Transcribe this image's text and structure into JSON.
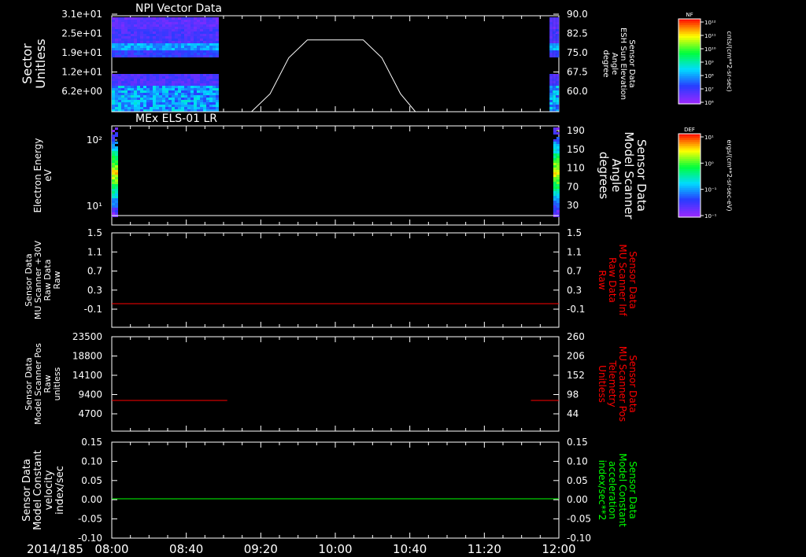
{
  "date_label": "2014/185",
  "time_ticks": [
    "08:00",
    "08:40",
    "09:20",
    "10:00",
    "10:40",
    "11:20",
    "12:00"
  ],
  "colors": {
    "background": "#000000",
    "foreground": "#ffffff",
    "red": "#ff0000",
    "green": "#00ff00"
  },
  "colorbars": [
    {
      "title": "NF",
      "ticks": [
        "10¹²",
        "10¹¹",
        "10¹⁰",
        "10⁹",
        "10⁸",
        "10⁷",
        "10⁶"
      ],
      "units": "cnts/(cm**2-sr-sec)"
    },
    {
      "title": "DEF",
      "ticks": [
        "10¹",
        "10⁰",
        "10⁻¹",
        "10⁻¹"
      ],
      "units": "ergs/(cm**2-sr-sec-eV)"
    }
  ],
  "chart_data": [
    {
      "type": "heatmap",
      "title": "NPI Vector Data",
      "ylabel_lines": [
        "Sector",
        "Unitless"
      ],
      "yticks_left": [
        "3.1e+01",
        "2.5e+01",
        "1.9e+01",
        "1.2e+01",
        "6.2e+00"
      ],
      "right_ylabel_lines": [
        "Sensor Data",
        "ESH Sun Elevation",
        "Angle",
        "degree"
      ],
      "yticks_right": [
        "90.0",
        "82.5",
        "75.0",
        "67.5",
        "60.0"
      ],
      "right_ylim": [
        52.5,
        90.0
      ],
      "line": {
        "x": [
          "08:00",
          "09:15",
          "09:25",
          "09:35",
          "09:45",
          "10:00",
          "10:15",
          "10:25",
          "10:35",
          "10:43",
          "12:00"
        ],
        "y": [
          52.5,
          52.5,
          60.0,
          75.0,
          82.5,
          82.5,
          82.5,
          75.0,
          60.0,
          52.5,
          52.5
        ]
      },
      "data_segments": [
        [
          "08:00",
          "08:56"
        ],
        [
          "11:55",
          "12:00"
        ]
      ]
    },
    {
      "type": "heatmap",
      "title": "MEx ELS-01 LR",
      "ylabel_lines": [
        "Electron Energy",
        "eV"
      ],
      "yticks_left": [
        "10²",
        "10¹"
      ],
      "right_ylabel_lines": [
        "Sensor Data",
        "Model Scanner",
        "Angle",
        "degrees"
      ],
      "yticks_right": [
        "190",
        "150",
        "110",
        "70",
        "30"
      ],
      "right_ylim": [
        0,
        190
      ],
      "line": {
        "x": [
          "08:00",
          "12:00"
        ],
        "y": [
          0,
          0
        ]
      },
      "data_segments": [
        [
          "08:00",
          "08:03"
        ],
        [
          "11:57",
          "12:00"
        ]
      ]
    },
    {
      "type": "line",
      "ylabel_lines": [
        "Sensor Data",
        "MU Scanner +30V",
        "Raw Data",
        "Raw"
      ],
      "yticks_left": [
        "1.5",
        "1.1",
        "0.7",
        "0.3",
        "-0.1"
      ],
      "right_ylabel_lines": [
        "Sensor Data",
        "MU Scanner Inf",
        "Raw Data",
        "Raw"
      ],
      "yticks_right": [
        "1.5",
        "1.1",
        "0.7",
        "0.3",
        "-0.1"
      ],
      "ylim": [
        -0.3,
        1.5
      ],
      "series": [
        {
          "color": "#ff0000",
          "segments": [
            {
              "x": [
                "08:00",
                "12:00"
              ],
              "y": [
                0.0,
                0.0
              ]
            }
          ]
        }
      ]
    },
    {
      "type": "line",
      "ylabel_lines": [
        "Sensor Data",
        "Model Scanner Pos",
        "Raw",
        "unitless"
      ],
      "yticks_left": [
        "23500",
        "18800",
        "14100",
        "9400",
        "4700"
      ],
      "right_ylabel_lines": [
        "Sensor Data",
        "MU Scanner Pos",
        "Telemetry",
        "Unitless"
      ],
      "yticks_right": [
        "260",
        "206",
        "152",
        "98",
        "44"
      ],
      "ylim": [
        0,
        23500
      ],
      "series": [
        {
          "color": "#ff0000",
          "segments": [
            {
              "x": [
                "08:00",
                "09:02"
              ],
              "y": [
                8000,
                8000
              ]
            },
            {
              "x": [
                "11:45",
                "12:00"
              ],
              "y": [
                8000,
                8000
              ]
            }
          ]
        }
      ]
    },
    {
      "type": "line",
      "ylabel_lines": [
        "Sensor Data",
        "Model Constant",
        "velocity",
        "index/sec"
      ],
      "yticks_left": [
        "0.15",
        "0.10",
        "0.05",
        "0.00",
        "-0.05",
        "-0.10"
      ],
      "right_ylabel_lines": [
        "Sensor Data",
        "Model Constant",
        "acceleration",
        "index/sec**2"
      ],
      "yticks_right": [
        "0.15",
        "0.10",
        "0.05",
        "0.00",
        "-0.05",
        "-0.10"
      ],
      "ylim": [
        -0.1,
        0.15
      ],
      "series": [
        {
          "color": "#00ff00",
          "segments": [
            {
              "x": [
                "08:00",
                "12:00"
              ],
              "y": [
                0.0,
                0.0
              ]
            }
          ]
        }
      ]
    }
  ]
}
